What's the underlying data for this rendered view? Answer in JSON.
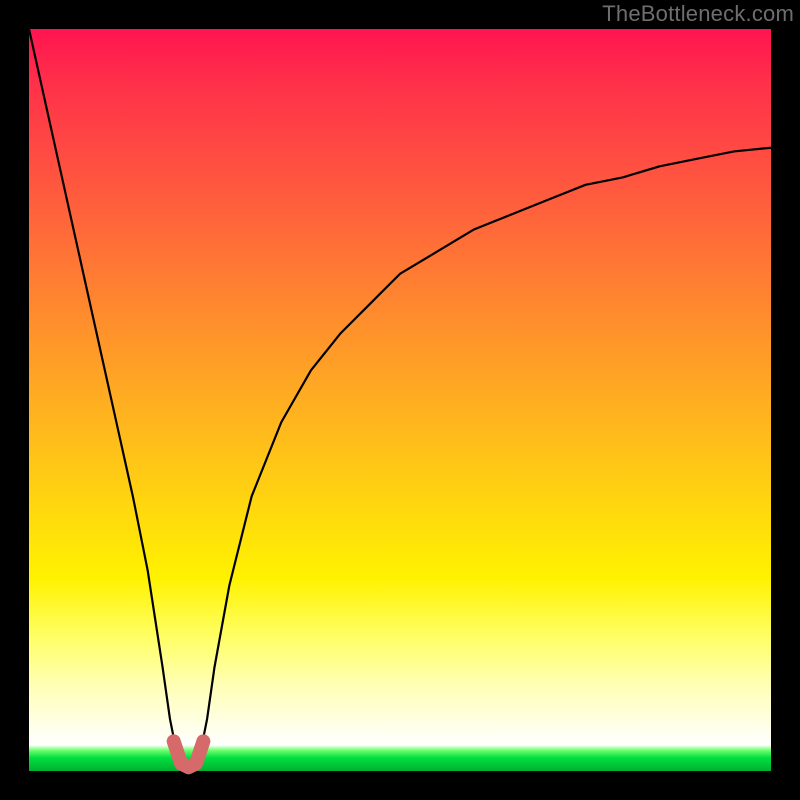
{
  "watermark": {
    "text": "TheBottleneck.com"
  },
  "chart_data": {
    "type": "line",
    "title": "",
    "xlabel": "",
    "ylabel": "",
    "xlim": [
      0,
      100
    ],
    "ylim": [
      0,
      100
    ],
    "grid": false,
    "legend": false,
    "series": [
      {
        "name": "bottleneck-curve",
        "x": [
          0,
          2,
          4,
          6,
          8,
          10,
          12,
          14,
          16,
          18,
          19,
          20,
          21,
          22,
          23,
          24,
          25,
          27,
          30,
          34,
          38,
          42,
          46,
          50,
          55,
          60,
          65,
          70,
          75,
          80,
          85,
          90,
          95,
          100
        ],
        "values": [
          100,
          91,
          82,
          73,
          64,
          55,
          46,
          37,
          27,
          14,
          7,
          2,
          0,
          0,
          2,
          7,
          14,
          25,
          37,
          47,
          54,
          59,
          63,
          67,
          70,
          73,
          75,
          77,
          79,
          80,
          81.5,
          82.5,
          83.5,
          84
        ]
      },
      {
        "name": "marker-band",
        "x": [
          19.5,
          20.5,
          21.5,
          22.5,
          23.5
        ],
        "values": [
          4,
          1,
          0.5,
          1,
          4
        ]
      }
    ],
    "colors": {
      "curve": "#000000",
      "marker": "#d66a6a"
    }
  }
}
